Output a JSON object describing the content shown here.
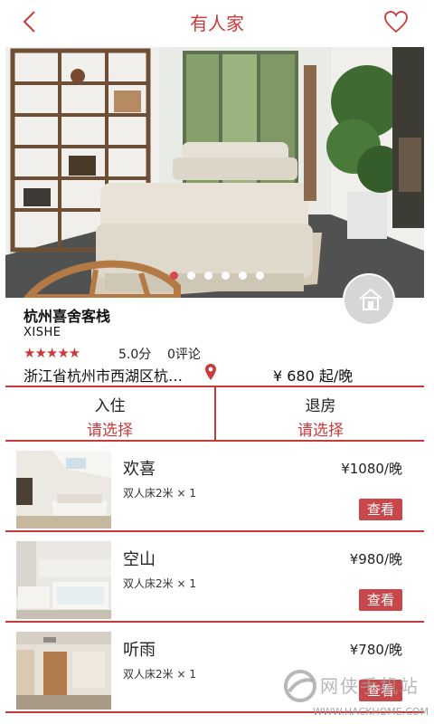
{
  "header": {
    "title": "有人家",
    "back_icon": "chevron-left-icon",
    "favorite_icon": "heart-icon",
    "accent_color": "#c8393b"
  },
  "carousel": {
    "slide_count": 6,
    "active_index": 0,
    "badge_icon": "home-icon"
  },
  "hotel": {
    "name": "杭州喜舍客栈",
    "name_en": "XISHE",
    "stars": "★★★★★",
    "rating": "5.0分",
    "reviews": "0评论",
    "address": "浙江省杭州市西湖区杭…",
    "price_from": "¥ 680 起/晚"
  },
  "dates": {
    "checkin_label": "入住",
    "checkin_value": "请选择",
    "checkout_label": "退房",
    "checkout_value": "请选择"
  },
  "rooms": [
    {
      "name": "欢喜",
      "bed": "双人床2米 × 1",
      "price": "¥1080/晚",
      "action": "查看"
    },
    {
      "name": "空山",
      "bed": "双人床2米 × 1",
      "price": "¥980/晚",
      "action": "查看"
    },
    {
      "name": "听雨",
      "bed": "双人床2米 × 1",
      "price": "¥780/晚",
      "action": "查看"
    }
  ],
  "watermark": {
    "cn": "网侠手机站",
    "en": "WWW.HACKHOME.COM"
  }
}
